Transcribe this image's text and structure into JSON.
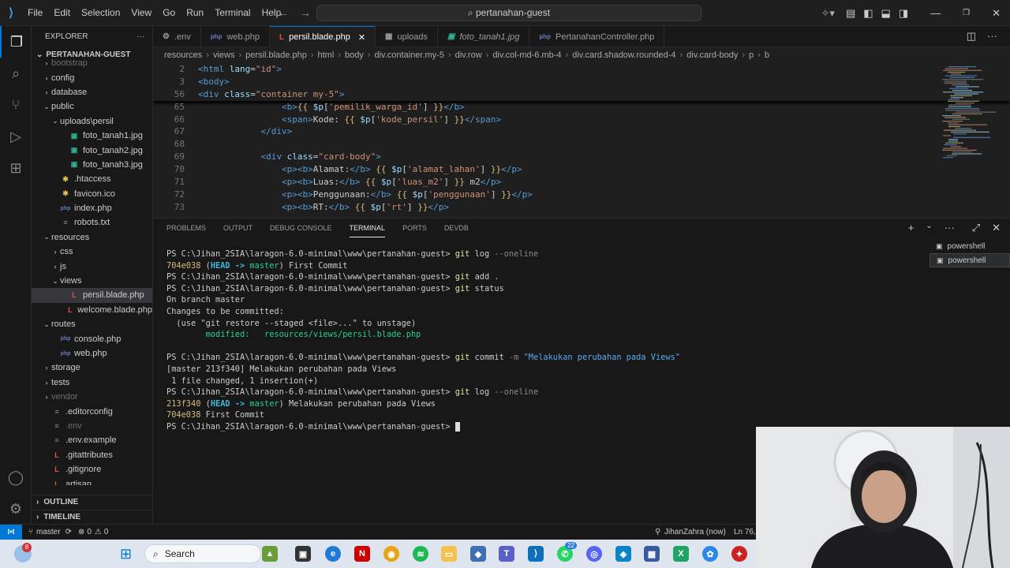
{
  "window": {
    "search_text": "pertanahan-guest"
  },
  "menu": [
    "File",
    "Edit",
    "Selection",
    "View",
    "Go",
    "Run",
    "Terminal",
    "Help"
  ],
  "explorer": {
    "header": "EXPLORER",
    "project": "PERTANAHAN-GUEST",
    "items": [
      {
        "label": "bootstrap",
        "depth": 1,
        "type": "folder",
        "dim": true
      },
      {
        "label": "config",
        "depth": 1,
        "type": "folder"
      },
      {
        "label": "database",
        "depth": 1,
        "type": "folder"
      },
      {
        "label": "public",
        "depth": 1,
        "type": "folder-open"
      },
      {
        "label": "uploads\\persil",
        "depth": 2,
        "type": "folder-open"
      },
      {
        "label": "foto_tanah1.jpg",
        "depth": 3,
        "type": "img"
      },
      {
        "label": "foto_tanah2.jpg",
        "depth": 3,
        "type": "img"
      },
      {
        "label": "foto_tanah3.jpg",
        "depth": 3,
        "type": "img"
      },
      {
        "label": ".htaccess",
        "depth": 2,
        "type": "star"
      },
      {
        "label": "favicon.ico",
        "depth": 2,
        "type": "star"
      },
      {
        "label": "index.php",
        "depth": 2,
        "type": "php"
      },
      {
        "label": "robots.txt",
        "depth": 2,
        "type": "dot"
      },
      {
        "label": "resources",
        "depth": 1,
        "type": "folder-open"
      },
      {
        "label": "css",
        "depth": 2,
        "type": "folder"
      },
      {
        "label": "js",
        "depth": 2,
        "type": "folder"
      },
      {
        "label": "views",
        "depth": 2,
        "type": "folder-open"
      },
      {
        "label": "persil.blade.php",
        "depth": 3,
        "type": "laravel",
        "selected": true
      },
      {
        "label": "welcome.blade.php",
        "depth": 3,
        "type": "laravel"
      },
      {
        "label": "routes",
        "depth": 1,
        "type": "folder-open"
      },
      {
        "label": "console.php",
        "depth": 2,
        "type": "php"
      },
      {
        "label": "web.php",
        "depth": 2,
        "type": "php"
      },
      {
        "label": "storage",
        "depth": 1,
        "type": "folder"
      },
      {
        "label": "tests",
        "depth": 1,
        "type": "folder"
      },
      {
        "label": "vendor",
        "depth": 1,
        "type": "folder",
        "dim": true
      },
      {
        "label": ".editorconfig",
        "depth": 1,
        "type": "dot"
      },
      {
        "label": ".env",
        "depth": 1,
        "type": "dot",
        "dim": true
      },
      {
        "label": ".env.example",
        "depth": 1,
        "type": "dot"
      },
      {
        "label": ".gitattributes",
        "depth": 1,
        "type": "laravel"
      },
      {
        "label": ".gitignore",
        "depth": 1,
        "type": "laravel"
      },
      {
        "label": "artisan",
        "depth": 1,
        "type": "laravel"
      }
    ],
    "outline": "OUTLINE",
    "timeline": "TIMELINE"
  },
  "tabs": [
    {
      "label": ".env",
      "icon": "⚙",
      "active": false
    },
    {
      "label": "web.php",
      "icon": "php",
      "active": false
    },
    {
      "label": "persil.blade.php",
      "icon": "L",
      "active": true
    },
    {
      "label": "uploads",
      "icon": "▦",
      "active": false
    },
    {
      "label": "foto_tanah1.jpg",
      "icon": "▣",
      "active": false,
      "italic": true
    },
    {
      "label": "PertanahanController.php",
      "icon": "php",
      "active": false
    }
  ],
  "breadcrumb": [
    "resources",
    "views",
    "persil.blade.php",
    "html",
    "body",
    "div.container.my-5",
    "div.row",
    "div.col-md-6.mb-4",
    "div.card.shadow.rounded-4",
    "div.card-body",
    "p",
    "b"
  ],
  "code": [
    {
      "ln": "2",
      "html": "<span class='t-tag'>&lt;html</span> <span class='t-attr'>lang</span>=<span class='t-str'>\"id\"</span><span class='t-tag'>&gt;</span>",
      "sticky": true
    },
    {
      "ln": "3",
      "html": "<span class='t-tag'>&lt;body&gt;</span>",
      "sticky": true
    },
    {
      "ln": "56",
      "html": "<span class='t-tag'>&lt;div</span> <span class='t-attr'>class</span>=<span class='t-str'>\"container my-5\"</span><span class='t-tag'>&gt;</span>",
      "sticky": true
    },
    {
      "ln": "65",
      "html": "                <span class='t-tag'>&lt;b&gt;</span><span class='t-b'>{{</span> <span class='t-v'>$p</span>[<span class='t-str'>'pemilik_warga_id'</span>] <span class='t-b'>}}</span><span class='t-tag'>&lt;/b&gt;</span>"
    },
    {
      "ln": "66",
      "html": "                <span class='t-tag'>&lt;span&gt;</span>Kode: <span class='t-b'>{{</span> <span class='t-v'>$p</span>[<span class='t-str'>'kode_persil'</span>] <span class='t-b'>}}</span><span class='t-tag'>&lt;/span&gt;</span>"
    },
    {
      "ln": "67",
      "html": "            <span class='t-tag'>&lt;/div&gt;</span>"
    },
    {
      "ln": "68",
      "html": ""
    },
    {
      "ln": "69",
      "html": "            <span class='t-tag'>&lt;div</span> <span class='t-attr'>class</span>=<span class='t-str'>\"card-body\"</span><span class='t-tag'>&gt;</span>"
    },
    {
      "ln": "70",
      "html": "                <span class='t-tag'>&lt;p&gt;&lt;b&gt;</span>Alamat:<span class='t-tag'>&lt;/b&gt;</span> <span class='t-b'>{{</span> <span class='t-v'>$p</span>[<span class='t-str'>'alamat_lahan'</span>] <span class='t-b'>}}</span><span class='t-tag'>&lt;/p&gt;</span>"
    },
    {
      "ln": "71",
      "html": "                <span class='t-tag'>&lt;p&gt;&lt;b&gt;</span>Luas:<span class='t-tag'>&lt;/b&gt;</span> <span class='t-b'>{{</span> <span class='t-v'>$p</span>[<span class='t-str'>'luas_m2'</span>] <span class='t-b'>}}</span> m2<span class='t-tag'>&lt;/p&gt;</span>"
    },
    {
      "ln": "72",
      "html": "                <span class='t-tag'>&lt;p&gt;&lt;b&gt;</span>Penggunaan:<span class='t-tag'>&lt;/b&gt;</span> <span class='t-b'>{{</span> <span class='t-v'>$p</span>[<span class='t-str'>'penggunaan'</span>] <span class='t-b'>}}</span><span class='t-tag'>&lt;/p&gt;</span>"
    },
    {
      "ln": "73",
      "html": "                <span class='t-tag'>&lt;p&gt;&lt;b&gt;</span>RT:<span class='t-tag'>&lt;/b&gt;</span> <span class='t-b'>{{</span> <span class='t-v'>$p</span>[<span class='t-str'>'rt'</span>] <span class='t-b'>}}</span><span class='t-tag'>&lt;/p&gt;</span>"
    }
  ],
  "panel_tabs": [
    {
      "label": "PROBLEMS",
      "active": false
    },
    {
      "label": "OUTPUT",
      "active": false
    },
    {
      "label": "DEBUG CONSOLE",
      "active": false
    },
    {
      "label": "TERMINAL",
      "active": true
    },
    {
      "label": "PORTS",
      "active": false
    },
    {
      "label": "DEVDB",
      "active": false
    }
  ],
  "terminal": [
    "<span>PS C:\\Jihan_2SIA\\laragon-6.0-minimal\\www\\pertanahan-guest&gt; </span><span class='tcmd'>git</span> log <span class='tdim'>--oneline</span>",
    "<span class='thash'>704e038</span> (<span class='thead'>HEAD -&gt; </span><span class='tgreen'>master</span>) First Commit",
    "PS C:\\Jihan_2SIA\\laragon-6.0-minimal\\www\\pertanahan-guest&gt; <span class='tcmd'>git</span> add .",
    "PS C:\\Jihan_2SIA\\laragon-6.0-minimal\\www\\pertanahan-guest&gt; <span class='tcmd'>git</span> status",
    "On branch master",
    "Changes to be committed:",
    "  (use \"git restore --staged &lt;file&gt;...\" to unstage)",
    "        <span class='tgreen'>modified:   resources/views/persil.blade.php</span>",
    "",
    "PS C:\\Jihan_2SIA\\laragon-6.0-minimal\\www\\pertanahan-guest&gt; <span class='tcmd'>git</span> commit <span class='tdim'>-m</span> <span class='tstr'>\"Melakukan perubahan pada Views\"</span>",
    "[master 213f340] Melakukan perubahan pada Views",
    " 1 file changed, 1 insertion(+)",
    "PS C:\\Jihan_2SIA\\laragon-6.0-minimal\\www\\pertanahan-guest&gt; <span class='tcmd'>git</span> log <span class='tdim'>--oneline</span>",
    "<span class='thash'>213f340</span> (<span class='thead'>HEAD -&gt; </span><span class='tgreen'>master</span>) Melakukan perubahan pada Views",
    "<span class='thash'>704e038</span> First Commit",
    "PS C:\\Jihan_2SIA\\laragon-6.0-minimal\\www\\pertanahan-guest&gt; <span class='cursor'></span>"
  ],
  "shells": [
    "powershell",
    "powershell"
  ],
  "status": {
    "branch": "master",
    "errors": "0",
    "warnings": "0",
    "blame": "JihanZahra (now)",
    "position": "Ln 76,"
  },
  "taskbar": {
    "search": "Search",
    "badge": "8",
    "badge2": "22"
  }
}
